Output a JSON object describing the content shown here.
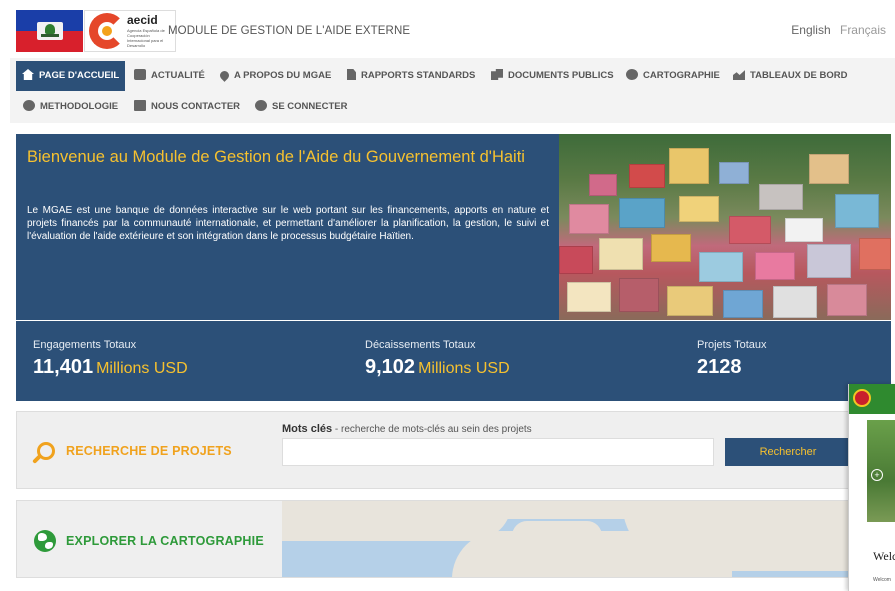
{
  "header": {
    "logo_word": "aecid",
    "logo_subtext": "Agencia Española de Cooperación Internacional para el Desarrollo",
    "app_title": "MODULE DE GESTION DE L'AIDE EXTERNE",
    "lang_english": "English",
    "lang_french": "Français"
  },
  "nav": {
    "items": [
      {
        "label": "PAGE D'ACCUEIL",
        "icon": "home-icon"
      },
      {
        "label": "ACTUALITÉ",
        "icon": "news-icon"
      },
      {
        "label": "A PROPOS DU MGAE",
        "icon": "map-pin-icon"
      },
      {
        "label": "RAPPORTS STANDARDS",
        "icon": "document-icon"
      },
      {
        "label": "DOCUMENTS PUBLICS",
        "icon": "documents-icon"
      },
      {
        "label": "CARTOGRAPHIE",
        "icon": "globe-icon"
      },
      {
        "label": "TABLEAUX DE BORD",
        "icon": "chart-icon"
      },
      {
        "label": "METHODOLOGIE",
        "icon": "check-circle-icon"
      },
      {
        "label": "NOUS CONTACTER",
        "icon": "contact-card-icon"
      },
      {
        "label": "SE CONNECTER",
        "icon": "power-icon"
      }
    ]
  },
  "hero": {
    "title": "Bienvenue au Module de Gestion de l'Aide du Gouvernement d'Haiti",
    "description": "Le MGAE est une banque de données interactive sur le web portant sur les financements, apports en nature et projets financés par la communauté internationale, et permettant d'améliorer la planification, la gestion, le suivi et l'évaluation de l'aide extérieure et son intégration dans le processus budgétaire Haïtien."
  },
  "stats": {
    "engagements": {
      "label": "Engagements Totaux",
      "value": "11,401",
      "unit": "Millions USD"
    },
    "decaissements": {
      "label": "Décaissements Totaux",
      "value": "9,102",
      "unit": "Millions USD"
    },
    "projets": {
      "label": "Projets Totaux",
      "value": "2128"
    }
  },
  "search": {
    "title": "RECHERCHE DE PROJETS",
    "keywords_label": "Mots clés",
    "keywords_hint": " - recherche de mots-clés au sein des projets",
    "input_value": "",
    "button_label": "Rechercher"
  },
  "map": {
    "title": "EXPLORER LA CARTOGRAPHIE"
  },
  "popup": {
    "heading": "Welc",
    "text": "Welcom"
  },
  "colors": {
    "primary_blue": "#2c5078",
    "accent_yellow": "#f6c12f",
    "search_orange": "#f0a21d",
    "map_green": "#2e9a3a"
  }
}
